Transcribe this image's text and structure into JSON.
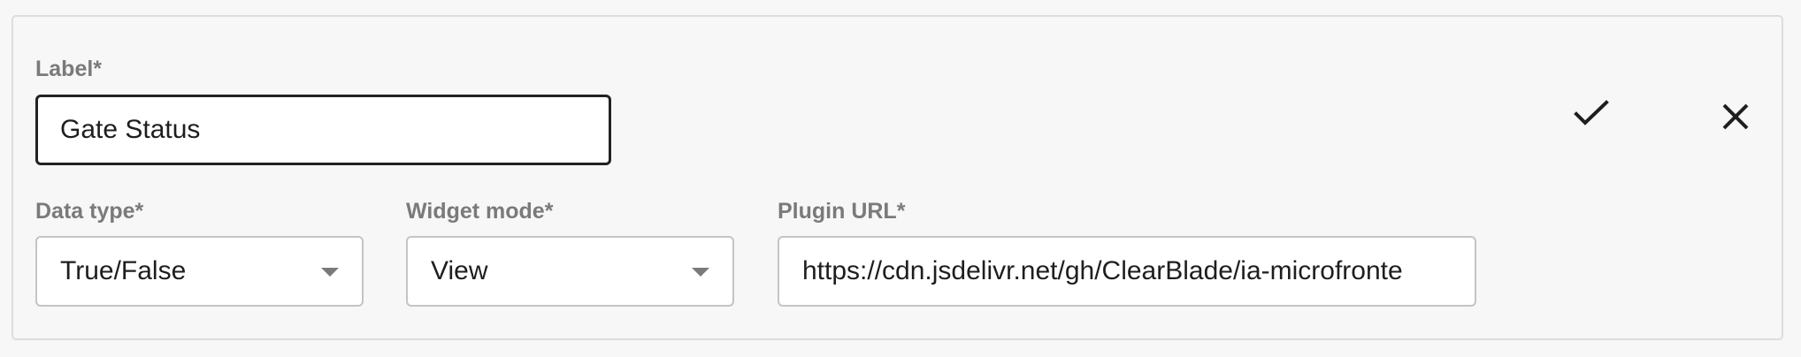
{
  "label_field": {
    "label": "Label*",
    "value": "Gate Status"
  },
  "data_type_field": {
    "label": "Data type*",
    "value": "True/False"
  },
  "widget_mode_field": {
    "label": "Widget mode*",
    "value": "View"
  },
  "plugin_url_field": {
    "label": "Plugin URL*",
    "value": "https://cdn.jsdelivr.net/gh/ClearBlade/ia-microfronte"
  },
  "actions": {
    "confirm_icon": "check-icon",
    "cancel_icon": "close-icon"
  },
  "colors": {
    "label_gray": "#7a7a7a",
    "border_gray": "#c4c4c4",
    "focus_border": "#222222",
    "icon": "#1e1e1e"
  }
}
